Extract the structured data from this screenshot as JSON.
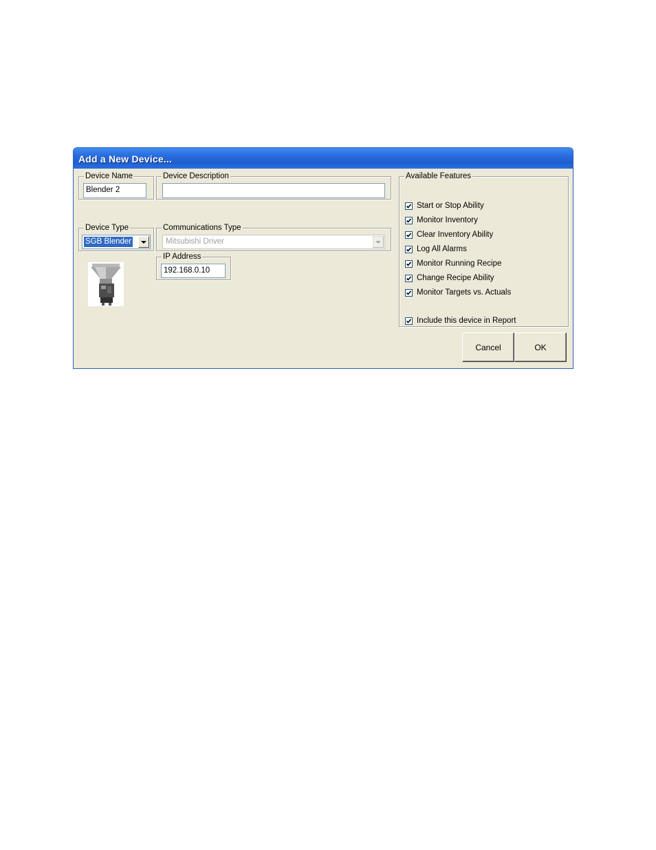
{
  "window": {
    "title": "Add a New Device..."
  },
  "device_name": {
    "label": "Device Name",
    "value": "Blender 2"
  },
  "device_description": {
    "label": "Device Description",
    "value": ""
  },
  "device_type": {
    "label": "Device Type",
    "value": "SGB Blender"
  },
  "communications_type": {
    "label": "Communications Type",
    "value": "Mitsubishi Driver",
    "enabled": false
  },
  "ip_address": {
    "label": "IP Address",
    "value": "192.168.0.10"
  },
  "device_image": {
    "icon": "blender-icon"
  },
  "features": {
    "label": "Available Features",
    "items": [
      {
        "label": "Start or Stop Ability",
        "checked": true
      },
      {
        "label": "Monitor Inventory",
        "checked": true
      },
      {
        "label": "Clear Inventory Ability",
        "checked": true
      },
      {
        "label": "Log All Alarms",
        "checked": true
      },
      {
        "label": "Monitor Running Recipe",
        "checked": true
      },
      {
        "label": "Change Recipe Ability",
        "checked": true
      },
      {
        "label": "Monitor Targets vs. Actuals",
        "checked": true
      }
    ],
    "report": {
      "label": "Include this device in Report",
      "checked": true
    }
  },
  "buttons": {
    "cancel": "Cancel",
    "ok": "OK"
  },
  "colors": {
    "titlebar": "#2a6ee0",
    "face": "#ece9d8",
    "selection": "#316ac5"
  }
}
